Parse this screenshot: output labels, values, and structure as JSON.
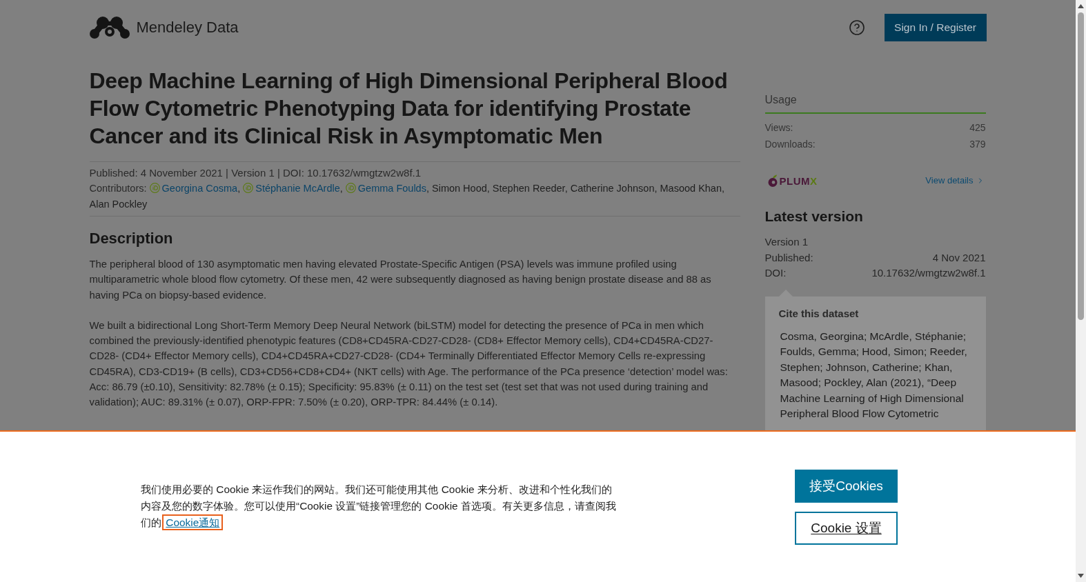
{
  "header": {
    "logo_text": "Mendeley Data",
    "sign_in_button": "Sign In / Register"
  },
  "dataset": {
    "title": "Deep Machine Learning of High Dimensional Peripheral Blood Flow Cytometric Phenotyping Data for identifying Prostate Cancer and its Clinical Risk in Asymptomatic Men",
    "meta": "Published: 4 November 2021 | Version 1 | DOI: 10.17632/wmgtzw2w8f.1",
    "contributors_label": "Contributors:",
    "contributors": [
      {
        "name": "Georgina Cosma",
        "orcid": true,
        "separator": ","
      },
      {
        "name": "Stéphanie McArdle",
        "orcid": true,
        "separator": ","
      },
      {
        "name": "Gemma Foulds",
        "orcid": true,
        "separator": ","
      },
      {
        "name": "Simon Hood",
        "orcid": false,
        "separator": ","
      },
      {
        "name": "Stephen Reeder",
        "orcid": false,
        "separator": ","
      },
      {
        "name": "Catherine Johnson",
        "orcid": false,
        "separator": ","
      },
      {
        "name": "Masood Khan",
        "orcid": false,
        "separator": ","
      },
      {
        "name": "Alan Pockley",
        "orcid": false
      }
    ]
  },
  "description": {
    "heading": "Description",
    "paragraphs": [
      "The peripheral blood of 130 asymptomatic men having elevated Prostate-Specific Antigen (PSA) levels was immune profiled using multiparametric whole blood flow cytometry. Of these men, 42 were subsequently diagnosed as having benign prostate disease and 88 as having PCa on biopsy-based evidence.",
      "We built a bidirectional Long Short-Term Memory Deep Neural Network (biLSTM) model for detecting the presence of PCa in men which combined the previously-identified phenotypic features (CD8+CD45RA-CD27-CD28- (CD8+ Effector Memory cells), CD4+CD45RA-CD27-CD28- (CD4+ Effector Memory cells), CD4+CD45RA+CD27-CD28- (CD4+ Terminally Differentiated Effector Memory Cells re-expressing CD45RA), CD3-CD19+ (B cells), CD3+CD56+CD8+CD4+ (NKT cells) with Age. The performance of the PCa presence ‘detection’ model was: Acc: 86.79 (±0.10), Sensitivity: 82.78% (± 0.15); Specificity: 95.83% (± 0.11) on the test set (test set that was not used during training and validation); AUC: 89.31% (± 0.07), ORP-FPR: 7.50% (± 0.20), ORP-TPR: 84.44% (± 0.14)."
    ]
  },
  "usage": {
    "heading": "Usage",
    "stats": [
      {
        "label": "Views:",
        "value": "425"
      },
      {
        "label": "Downloads:",
        "value": "379"
      }
    ],
    "plumx_logo": {
      "main": "PLUM",
      "accent": "X"
    },
    "view_details": "View details"
  },
  "latest_version": {
    "heading": "Latest version",
    "version": "Version 1",
    "rows": [
      {
        "label": "Published:",
        "value": "4 Nov 2021"
      },
      {
        "label": "DOI:",
        "value": "10.17632/wmgtzw2w8f.1"
      }
    ]
  },
  "cite": {
    "heading": "Cite this dataset",
    "text": "Cosma, Georgina; McArdle, Stéphanie; Foulds, Gemma; Hood, Simon; Reeder, Stephen; Johnson, Catherine; Khan, Masood; Pockley, Alan (2021), “Deep Machine Learning of High Dimensional Peripheral Blood Flow Cytometric"
  },
  "cookie_banner": {
    "text": "我们使用必要的 Cookie 来运作我们的网站。我们还可能使用其他 Cookie 来分析、改进和个性化我们的内容及您的数字体验。您可以使用“Cookie 设置”链接管理您的 Cookie 首选项。有关更多信息，请查阅我们的",
    "link": {
      "text": "Cookie通知",
      "focused": true
    },
    "buttons": [
      {
        "label": "接受Cookies",
        "kind": "primary"
      },
      {
        "label": "Cookie 设置",
        "kind": "secondary"
      }
    ]
  }
}
